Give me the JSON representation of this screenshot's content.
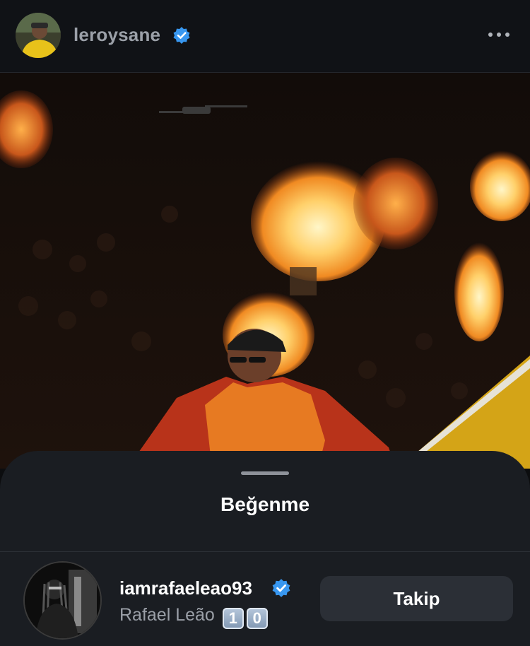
{
  "post": {
    "username": "leroysane",
    "verified": true,
    "avatar_icon": "profile-avatar",
    "more_icon": "more-horizontal-icon"
  },
  "sheet": {
    "title": "Beğenme"
  },
  "liker": {
    "username": "iamrafaeleao93",
    "verified": true,
    "full_name": "Rafael Leão",
    "emoji_digits": [
      "1",
      "0"
    ],
    "follow_label": "Takip"
  },
  "colors": {
    "background": "#0c0d0f",
    "sheet": "#1a1d22",
    "verified_blue": "#3897f0",
    "button": "#2b2f36"
  }
}
